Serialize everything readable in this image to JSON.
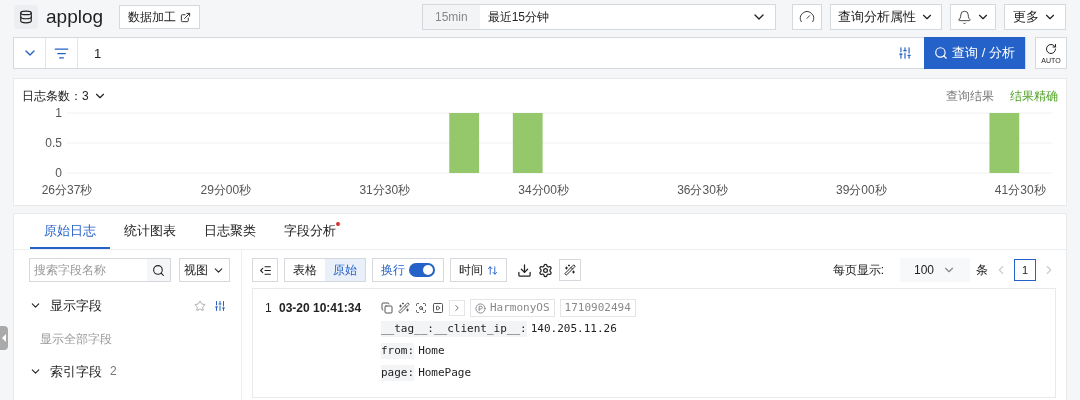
{
  "header": {
    "title": "applog",
    "data_process": "数据加工",
    "time_range": {
      "short": "15min",
      "label": "最近15分钟"
    },
    "query_attributes": "查询分析属性",
    "more": "更多"
  },
  "query": {
    "value": "1",
    "submit": "查询 / 分析",
    "auto": "AUTO"
  },
  "histogram": {
    "count_label": "日志条数：",
    "count": "3",
    "links": [
      {
        "label": "查询结果",
        "kind": "plain"
      },
      {
        "label": "结果精确",
        "kind": "success"
      }
    ],
    "chart_data": {
      "type": "bar",
      "categories": [
        "26分37秒",
        null,
        null,
        null,
        null,
        "29分00秒",
        null,
        null,
        null,
        null,
        "31分30秒",
        null,
        null,
        null,
        null,
        "34分00秒",
        null,
        null,
        null,
        null,
        "36分30秒",
        null,
        null,
        null,
        null,
        "39分00秒",
        null,
        null,
        null,
        null,
        "41分30秒"
      ],
      "values": [
        0,
        0,
        0,
        0,
        0,
        0,
        0,
        0,
        0,
        0,
        0,
        0,
        1,
        0,
        1,
        0,
        0,
        0,
        0,
        0,
        0,
        0,
        0,
        0,
        0,
        0,
        0,
        0,
        0,
        1,
        0
      ],
      "ylim": [
        0,
        1
      ],
      "yticks": [
        {
          "value": 0,
          "label": "0"
        },
        {
          "value": 0.5,
          "label": "0.5"
        },
        {
          "value": 1,
          "label": "1"
        }
      ]
    }
  },
  "tabs": [
    {
      "label": "原始日志",
      "selected": true,
      "dot": false
    },
    {
      "label": "统计图表",
      "selected": false,
      "dot": false
    },
    {
      "label": "日志聚类",
      "selected": false,
      "dot": false
    },
    {
      "label": "字段分析",
      "selected": false,
      "dot": true
    }
  ],
  "sidebar": {
    "search_placeholder": "搜索字段名称",
    "view": "视图",
    "sections": [
      {
        "title": "显示字段",
        "expanded": true,
        "link": "显示全部字段"
      },
      {
        "title": "索引字段",
        "expanded": true,
        "count": "2"
      }
    ]
  },
  "toolbar": {
    "modes": [
      {
        "label": "表格",
        "selected": false
      },
      {
        "label": "原始",
        "selected": true
      }
    ],
    "wrap": {
      "label": "换行",
      "on": true
    },
    "sort": "时间",
    "page_size_label": "每页显示:",
    "page_size": "100",
    "unit": "条",
    "page": "1"
  },
  "logs": [
    {
      "index": "1",
      "time": "03-20 10:41:34",
      "source": "HarmonyOS",
      "timestamp": "1710902494",
      "fields": [
        {
          "key": "__tag__:__client_ip__:",
          "value": "140.205.11.26"
        },
        {
          "key": "from:",
          "value": "Home"
        },
        {
          "key": "page:",
          "value": "HomePage"
        }
      ]
    }
  ]
}
